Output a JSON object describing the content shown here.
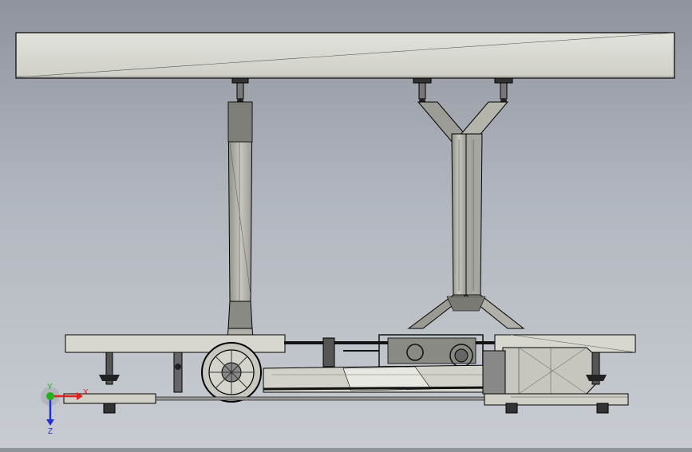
{
  "viewport": {
    "background_top": "#8f949c",
    "background_bottom": "#c8ccd2",
    "part_fill": "#d9d9d2",
    "part_shade": "#a3a39c",
    "edge_color": "#000000"
  },
  "triad": {
    "x_label": "X",
    "y_label": "Y",
    "z_label": "Z",
    "x_color": "#e02020",
    "y_color": "#20b020",
    "z_color": "#2030d0"
  }
}
